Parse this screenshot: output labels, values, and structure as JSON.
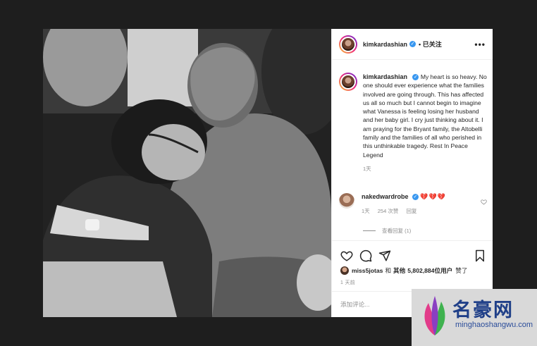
{
  "post": {
    "author": "kimkardashian",
    "follow_status": "已关注",
    "more_glyph": "•••",
    "caption_author": "kimkardashian",
    "caption_text": "My heart is so heavy. No one should ever experience what the families involved are going through. This has affected us all so much but I cannot begin to imagine what Vanessa is feeling losing her husband and her baby girl. I cry just thinking about it. I am praying for the Bryant family, the Altobelli family and the families of all who perished in this unthinkable tragedy. Rest In Peace Legend",
    "caption_time": "1天",
    "verified_glyph": "✓"
  },
  "comment": {
    "author": "nakedwardrobe",
    "hearts": "💔💔💔",
    "time": "1天",
    "likes": "254 次赞",
    "reply": "回复",
    "view_replies": "查看回复 (1)"
  },
  "likes_row": {
    "user": "miss5jotas",
    "and": "和",
    "others_prefix": "其他",
    "count": "5,802,884",
    "suffix": "位用户",
    "action": "赞了"
  },
  "post_time": "1 天前",
  "add_comment_placeholder": "添加评论...",
  "watermark": {
    "name": "名豪网",
    "url": "minghaoshangwu.com"
  },
  "icons": {
    "like": "heart-icon",
    "comment": "comment-icon",
    "share": "share-icon",
    "save": "bookmark-icon",
    "more": "more-icon",
    "verified": "verified-icon",
    "comment_like": "heart-icon"
  }
}
